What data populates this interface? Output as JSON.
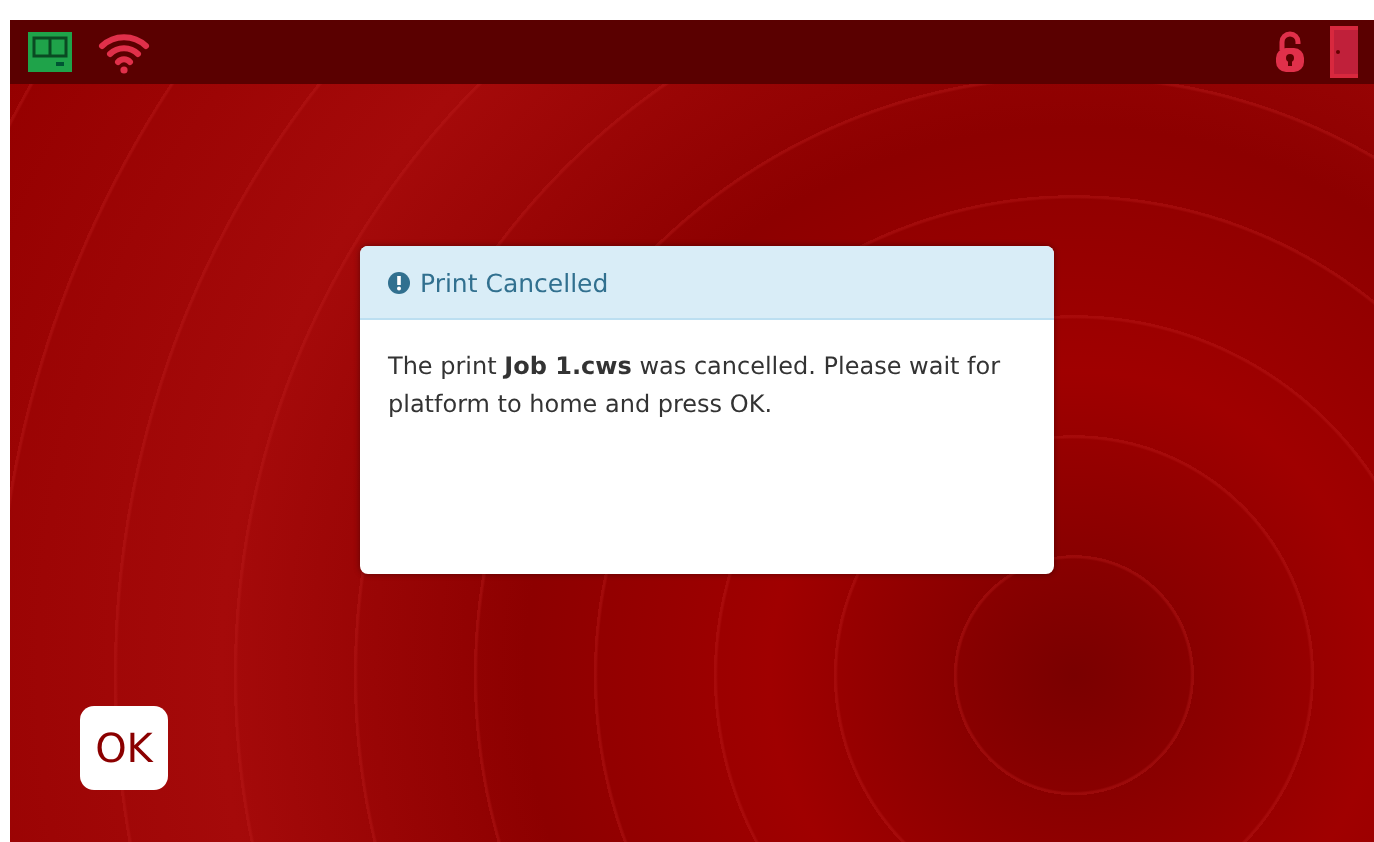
{
  "status_bar": {
    "printer_connected": true,
    "wifi_connected": true,
    "locked": false
  },
  "dialog": {
    "title": "Print Cancelled",
    "message": "The print **Job 1.cws** was cancelled. Please wait for platform to home and press OK."
  },
  "buttons": [
    {
      "label": "OK"
    }
  ]
}
